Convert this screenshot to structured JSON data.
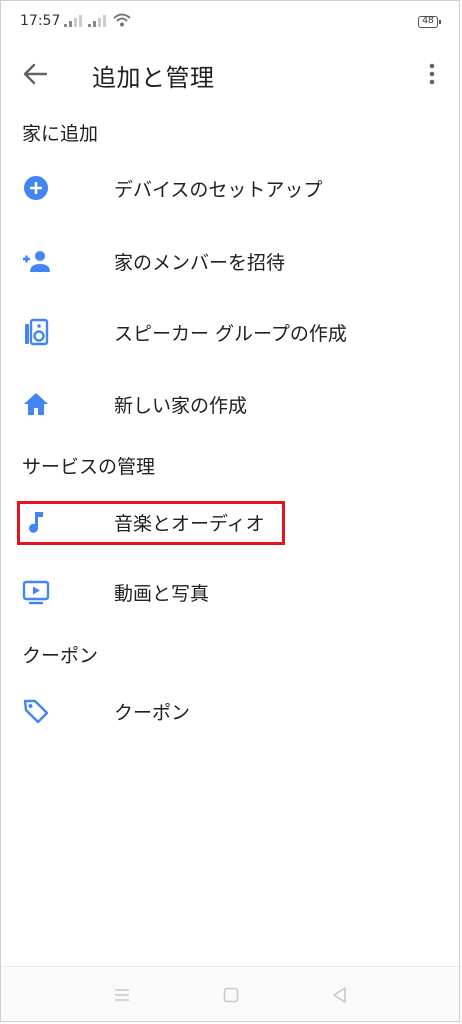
{
  "status_bar": {
    "time": "17:57",
    "battery": "48"
  },
  "app_bar": {
    "title": "追加と管理",
    "back_icon": "arrow-back-icon",
    "menu_icon": "more-vert-icon"
  },
  "sections": {
    "add_to_home": {
      "heading": "家に追加",
      "items": [
        {
          "label": "デバイスのセットアップ",
          "icon": "add-circle-icon"
        },
        {
          "label": "家のメンバーを招待",
          "icon": "person-add-icon"
        },
        {
          "label": "スピーカー グループの作成",
          "icon": "speaker-group-icon"
        },
        {
          "label": "新しい家の作成",
          "icon": "home-icon"
        }
      ]
    },
    "manage_services": {
      "heading": "サービスの管理",
      "items": [
        {
          "label": "音楽とオーディオ",
          "icon": "music-note-icon"
        },
        {
          "label": "動画と写真",
          "icon": "video-icon"
        }
      ]
    },
    "coupons": {
      "heading": "クーポン",
      "items": [
        {
          "label": "クーポン",
          "icon": "tag-icon"
        }
      ]
    }
  },
  "colors": {
    "accent": "#4285f4",
    "highlight": "#e3141e",
    "text": "#202124"
  }
}
